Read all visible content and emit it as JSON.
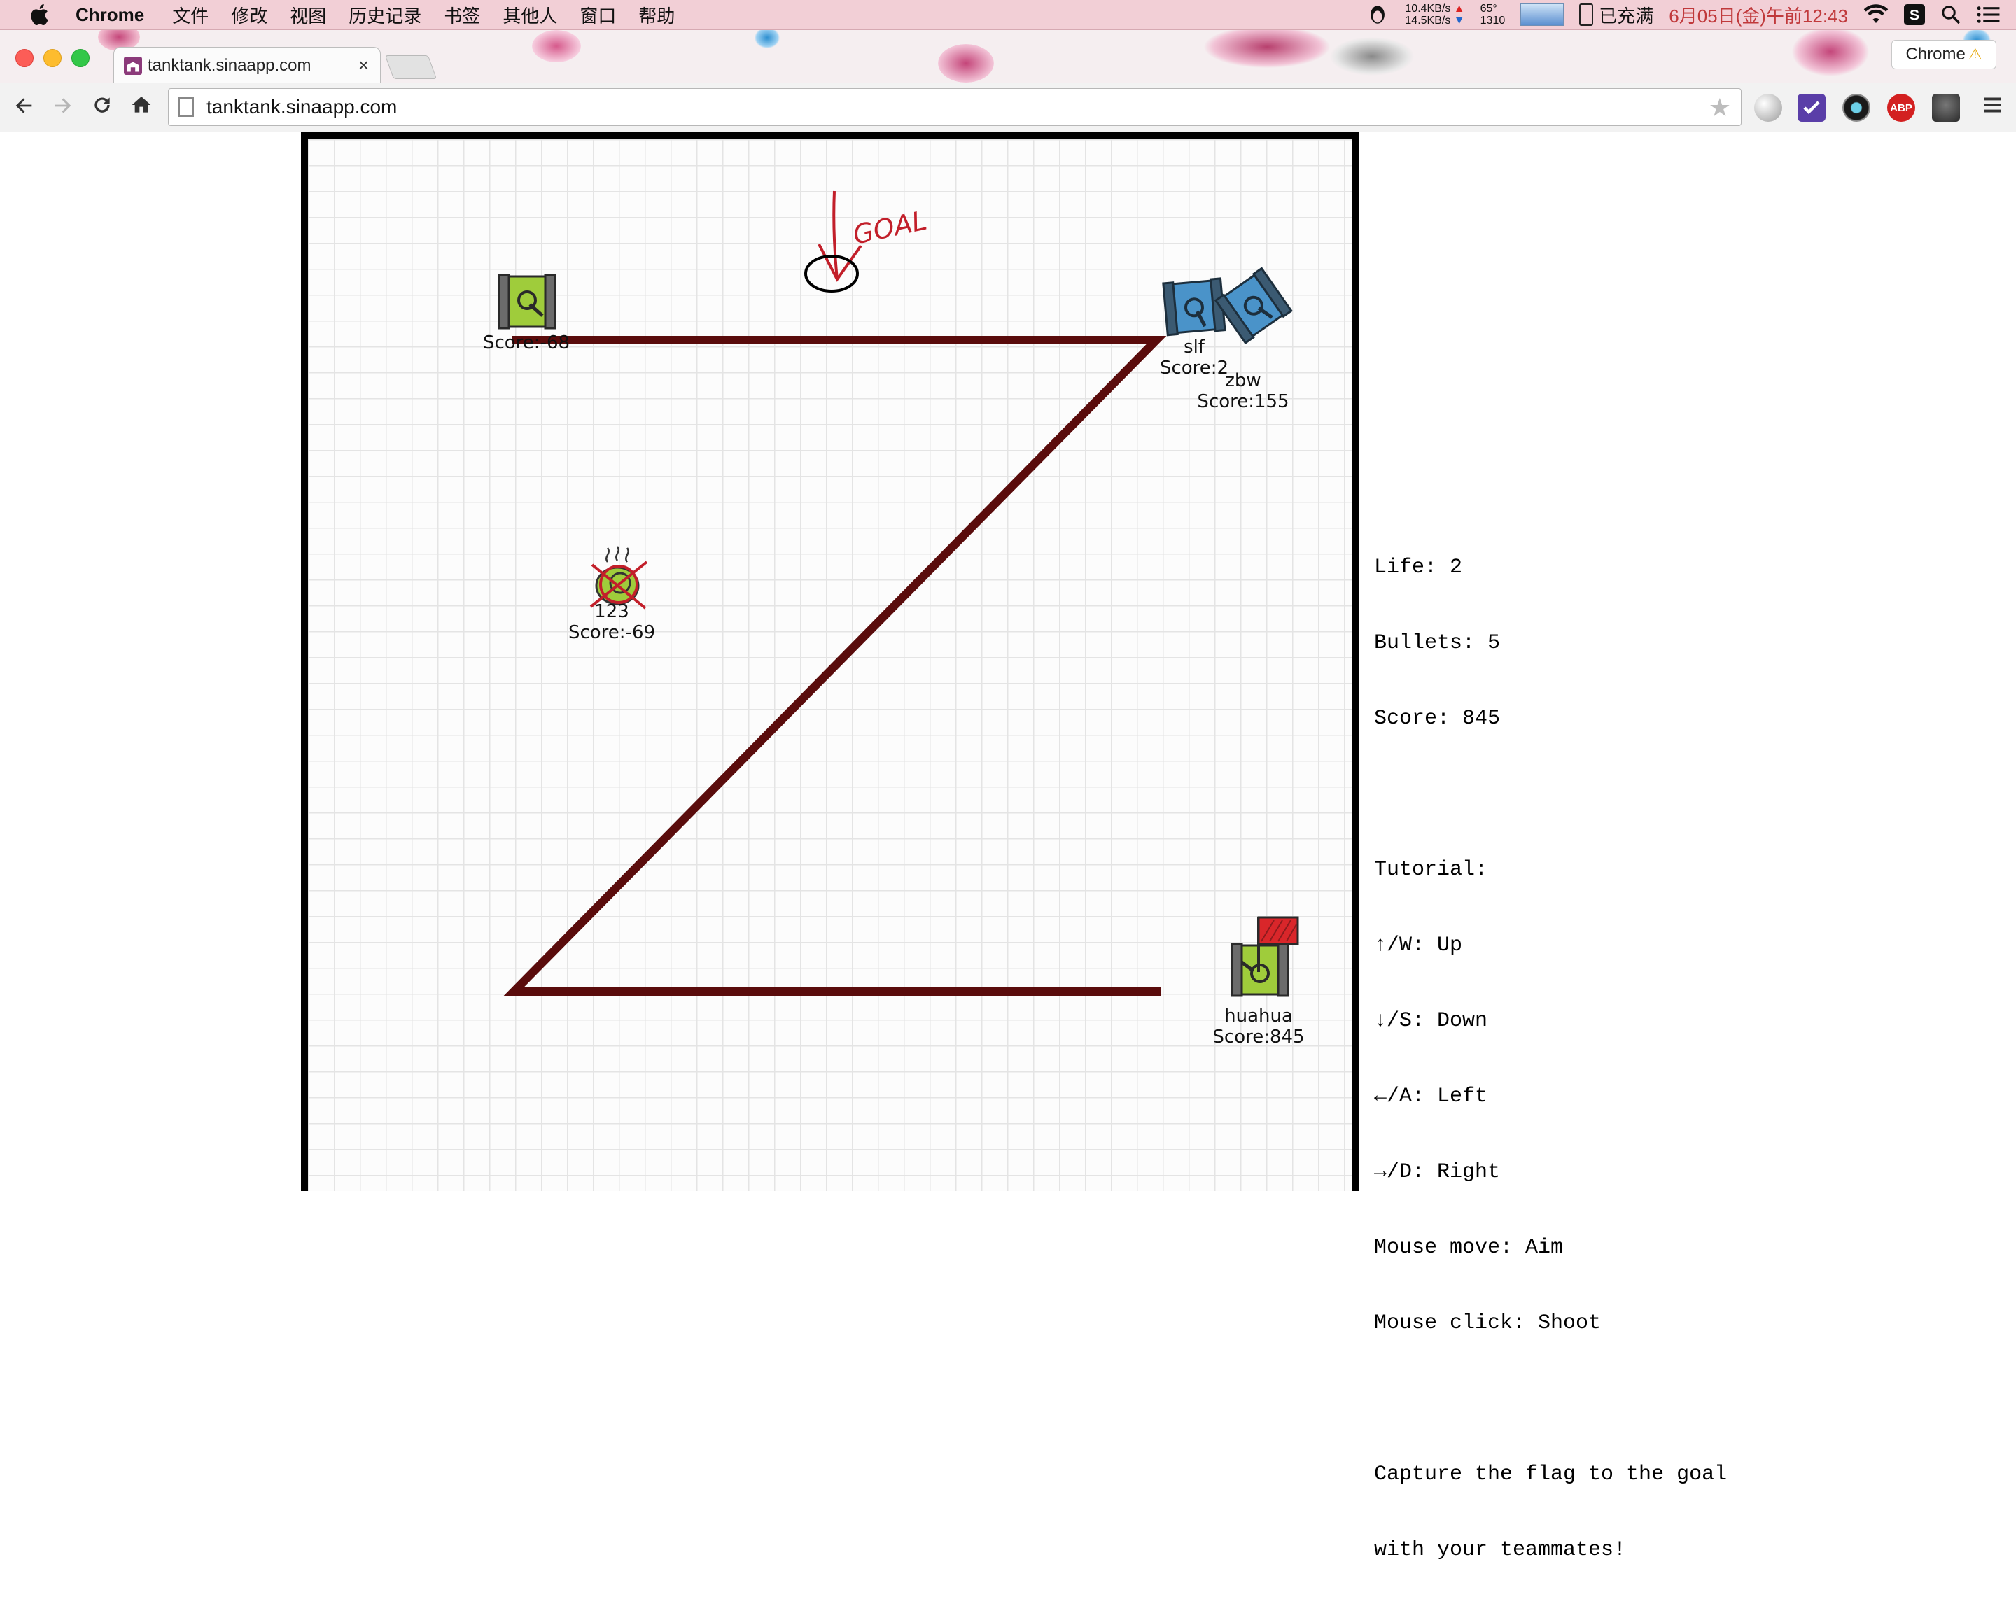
{
  "menubar": {
    "app_name": "Chrome",
    "menus": [
      "文件",
      "修改",
      "视图",
      "历史记录",
      "书签",
      "其他人",
      "窗口",
      "帮助"
    ],
    "net_up": "10.4KB/s",
    "net_down": "14.5KB/s",
    "temp_top": "65°",
    "temp_bottom": "1310",
    "battery": "已充满",
    "clock": "6月05日(金)午前12:43"
  },
  "tabs": {
    "active_title": "tanktank.sinaapp.com",
    "profile": "Chrome"
  },
  "toolbar": {
    "url": "tanktank.sinaapp.com",
    "extensions": [
      "globe-extension-icon",
      "checkmark-extension-icon",
      "eye-extension-icon",
      "adblock-extension-icon",
      "evernote-extension-icon"
    ],
    "adblock_label": "ABP"
  },
  "game": {
    "goal_label": "GOAL",
    "players": [
      {
        "id": "top-left-tank",
        "name": "",
        "score": "Score:-68",
        "team_color": "#9fcc3b",
        "state": "alive"
      },
      {
        "id": "slf-tank",
        "name": "slf",
        "score": "Score:2",
        "team_color": "#4a93c9",
        "state": "alive"
      },
      {
        "id": "zbw-tank",
        "name": "zbw",
        "score": "Score:155",
        "team_color": "#4a93c9",
        "state": "alive"
      },
      {
        "id": "dead-tank",
        "name": "123",
        "score": "Score:-69",
        "team_color": "#9fcc3b",
        "state": "destroyed"
      },
      {
        "id": "huahua-tank",
        "name": "huahua",
        "score": "Score:845",
        "team_color": "#9fcc3b",
        "state": "carrying-flag"
      }
    ],
    "wall_color": "#5a0c0c",
    "flag_color": "#d9262a"
  },
  "info": {
    "life": "Life: 2",
    "bullets": "Bullets: 5",
    "score": "Score: 845",
    "tutorial_title": "Tutorial:",
    "controls": [
      "↑/W: Up",
      "↓/S: Down",
      "←/A: Left",
      "→/D: Right",
      "Mouse move: Aim",
      "Mouse click: Shoot"
    ],
    "objective_line1": "Capture the flag to the goal",
    "objective_line2": "with your teammates!"
  }
}
